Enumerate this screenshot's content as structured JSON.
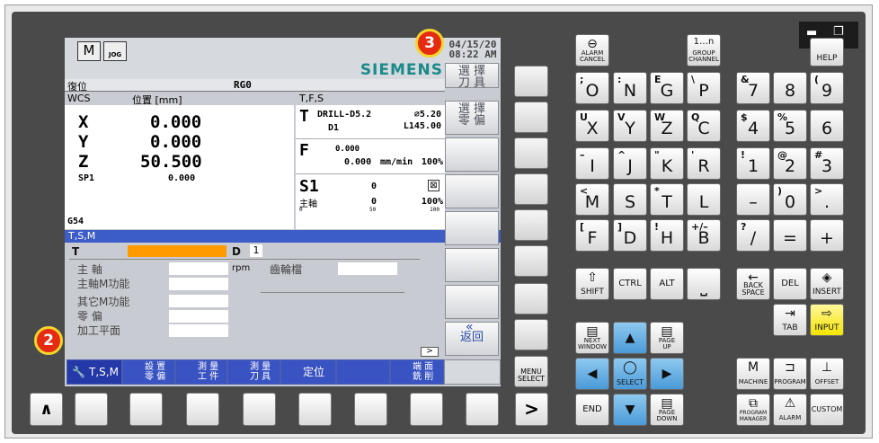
{
  "window": {
    "minimize": "▬",
    "restore": "❐"
  },
  "badges": {
    "b2": "2",
    "b3": "3"
  },
  "status": {
    "mode": "JOG",
    "date": "04/15/20",
    "time": "08:22 AM",
    "brand": "SIEMENS",
    "reset": "復位",
    "rg": "RG0"
  },
  "wcs": {
    "header": "WCS",
    "pos_label": "位置 [mm]",
    "axes": [
      {
        "name": "X",
        "value": "0.000"
      },
      {
        "name": "Y",
        "value": "0.000"
      },
      {
        "name": "Z",
        "value": "50.500"
      },
      {
        "name": "SP1",
        "value": "0.000"
      }
    ],
    "g": "G54"
  },
  "tfs": {
    "header": "T,F,S",
    "tool": "DRILL-D5.2",
    "dia": "⌀5.20",
    "d": "D1",
    "len": "L145.00",
    "f_val": "0.000",
    "f_val2": "0.000",
    "f_unit": "mm/min",
    "f_pct": "100%",
    "s": "S1",
    "s_val": "0",
    "s_label": "主軸",
    "s_val2": "0",
    "s_pct": "100%",
    "scale": [
      "0",
      "50",
      "100"
    ]
  },
  "tsm": {
    "title": "T,S,M",
    "t": "T",
    "d": "D",
    "d_val": "1",
    "spindle": "主 軸",
    "rpm": "rpm",
    "gear": "齒輪檔",
    "spindle_m": "主軸M功能",
    "other_m": "其它M功能",
    "zero": "零 偏",
    "plane": "加工平面",
    "arrow": ">"
  },
  "vsoft": [
    "選 擇\n刀 具",
    "選 擇\n零 偏",
    "",
    "",
    "",
    "",
    "",
    "返回"
  ],
  "hsoft": [
    {
      "label": "T,S,M"
    },
    {
      "label": "設 置\n零 偏"
    },
    {
      "label": "測 量\n工 件"
    },
    {
      "label": "測 量\n刀 具"
    },
    {
      "label": "定位"
    },
    {
      "label": ""
    },
    {
      "label": "端 面\n銑 削"
    }
  ],
  "left_keys": {
    "up": "∧",
    "right": ">",
    "menu": "MENU\nSELECT"
  },
  "keys": {
    "alarm": "ALARM\nCANCEL",
    "group": "GROUP\nCHANNEL",
    "help": "HELP",
    "alpha": [
      [
        "O",
        ";"
      ],
      [
        "N",
        ":"
      ],
      [
        "G",
        "E"
      ],
      [
        "P",
        "\\"
      ],
      [
        "X",
        "U"
      ],
      [
        "Y",
        "V"
      ],
      [
        "Z",
        "W"
      ],
      [
        "C",
        "Q"
      ],
      [
        "I",
        "–"
      ],
      [
        "J",
        "^"
      ],
      [
        "K",
        "\""
      ],
      [
        "R",
        "'"
      ],
      [
        "M",
        "<"
      ],
      [
        "S",
        ""
      ],
      [
        "T",
        "*"
      ],
      [
        "L",
        ""
      ],
      [
        "F",
        "["
      ],
      [
        "D",
        "]"
      ],
      [
        "H",
        "!"
      ],
      [
        "B",
        "+/–"
      ]
    ],
    "num": [
      [
        "7",
        "&"
      ],
      [
        "8",
        ""
      ],
      [
        "9",
        "("
      ],
      [
        "4",
        "$"
      ],
      [
        "5",
        "%"
      ],
      [
        "6",
        ""
      ],
      [
        "1",
        "!"
      ],
      [
        "2",
        "@"
      ],
      [
        "3",
        "#"
      ],
      [
        "–",
        ""
      ],
      [
        "0",
        ")"
      ],
      [
        ".",
        ">"
      ],
      [
        "/",
        "?"
      ],
      [
        "=",
        ""
      ],
      [
        "+",
        ""
      ]
    ],
    "shift": "SHIFT",
    "ctrl": "CTRL",
    "alt": "ALT",
    "space": "",
    "back": "BACK\nSPACE",
    "del": "DEL",
    "insert": "INSERT",
    "tab": "TAB",
    "input": "INPUT",
    "next": "NEXT\nWINDOW",
    "pageup": "PAGE\nUP",
    "select": "SELECT",
    "end": "END",
    "pagedown": "PAGE\nDOWN",
    "machine": "MACHINE",
    "program": "PROGRAM",
    "offset": "OFFSET",
    "progman": "PROGRAM\nMANAGER",
    "alarm2": "ALARM",
    "custom": "CUSTOM"
  },
  "colors": {
    "panel": "#4a4a4a",
    "blue_bar": "#3c5cc8",
    "orange": "#ff9a00",
    "siemens": "#1a8a8a",
    "badge": "#e52b12"
  }
}
